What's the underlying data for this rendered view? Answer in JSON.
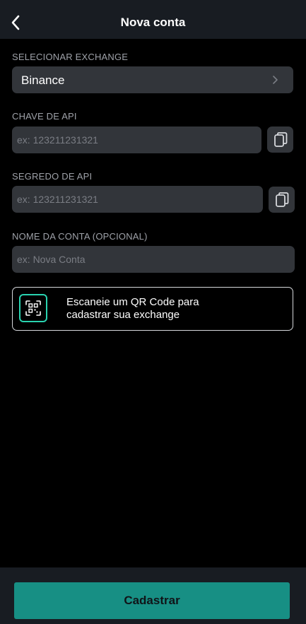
{
  "header": {
    "title": "Nova conta"
  },
  "exchange": {
    "label": "SELECIONAR EXCHANGE",
    "selected": "Binance"
  },
  "api_key": {
    "label": "CHAVE DE API",
    "placeholder": "ex: 123211231321"
  },
  "api_secret": {
    "label": "SEGREDO DE API",
    "placeholder": "ex: 123211231321"
  },
  "account_name": {
    "label": "NOME DA CONTA (OPCIONAL)",
    "placeholder": "ex: Nova Conta"
  },
  "qr": {
    "line1": "Escaneie um QR Code para",
    "line2": "cadastrar sua exchange",
    "icon": "qr-scan-icon"
  },
  "footer": {
    "submit_label": "Cadastrar"
  },
  "colors": {
    "accent": "#29d3b0",
    "button": "#178f84",
    "field": "#32353a",
    "header": "#181c22"
  }
}
